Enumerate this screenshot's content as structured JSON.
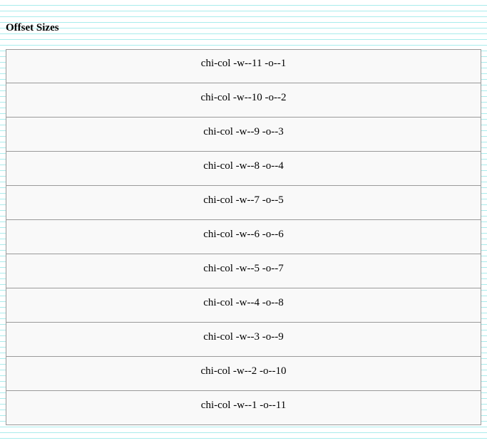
{
  "section": {
    "title": "Offset Sizes"
  },
  "rows": [
    {
      "label": "chi-col -w--11 -o--1"
    },
    {
      "label": "chi-col -w--10 -o--2"
    },
    {
      "label": "chi-col -w--9 -o--3"
    },
    {
      "label": "chi-col -w--8 -o--4"
    },
    {
      "label": "chi-col -w--7 -o--5"
    },
    {
      "label": "chi-col -w--6 -o--6"
    },
    {
      "label": "chi-col -w--5 -o--7"
    },
    {
      "label": "chi-col -w--4 -o--8"
    },
    {
      "label": "chi-col -w--3 -o--9"
    },
    {
      "label": "chi-col -w--2 -o--10"
    },
    {
      "label": "chi-col -w--1 -o--11"
    }
  ]
}
